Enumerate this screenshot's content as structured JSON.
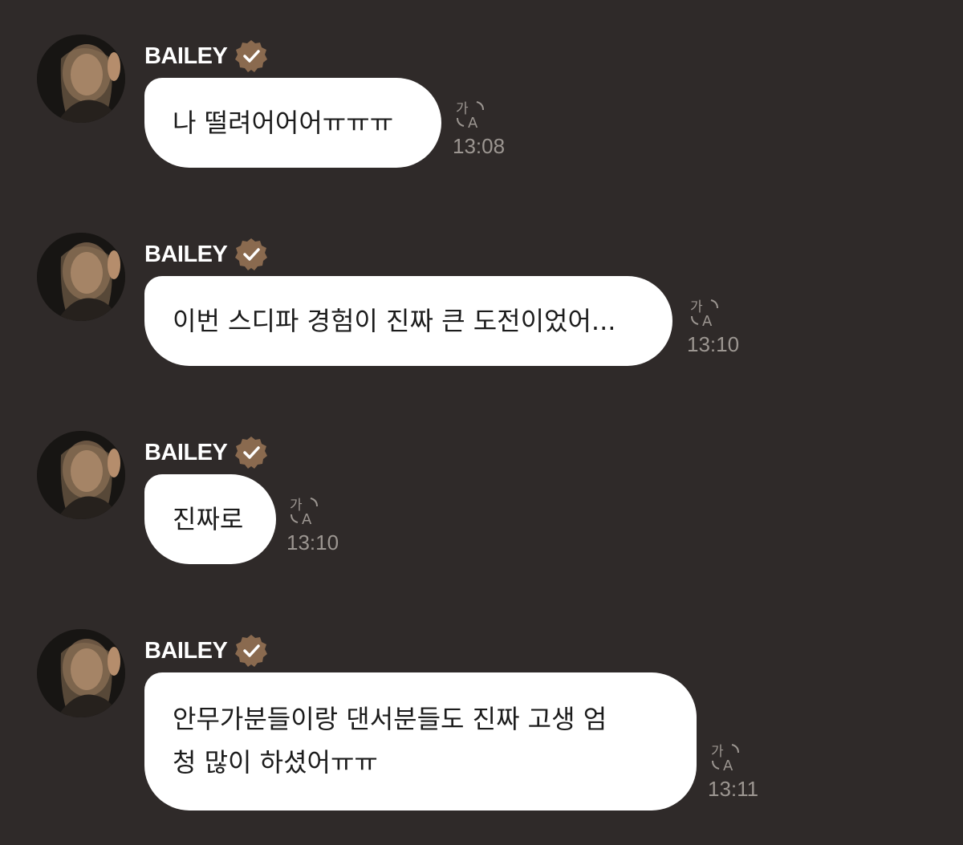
{
  "messages": [
    {
      "sender": "BAILEY",
      "text": "나 떨려어어어ㅠㅠㅠ",
      "time": "13:08"
    },
    {
      "sender": "BAILEY",
      "text": "이번 스디파 경험이 진짜 큰 도전이었어...",
      "time": "13:10"
    },
    {
      "sender": "BAILEY",
      "text": "진짜로",
      "time": "13:10"
    },
    {
      "sender": "BAILEY",
      "text_line1": "안무가분들이랑 댄서분들도 진짜 고생 엄",
      "text_line2": "청 많이 하셨어ㅠㅠ",
      "time": "13:11"
    }
  ],
  "icons": {
    "verified": "verified-badge-icon",
    "translate": "translate-icon",
    "avatar": "avatar-photo"
  },
  "colors": {
    "background": "#2f2a29",
    "badge": "#8a6a4f",
    "bubble": "#ffffff",
    "time": "#9c9691"
  }
}
